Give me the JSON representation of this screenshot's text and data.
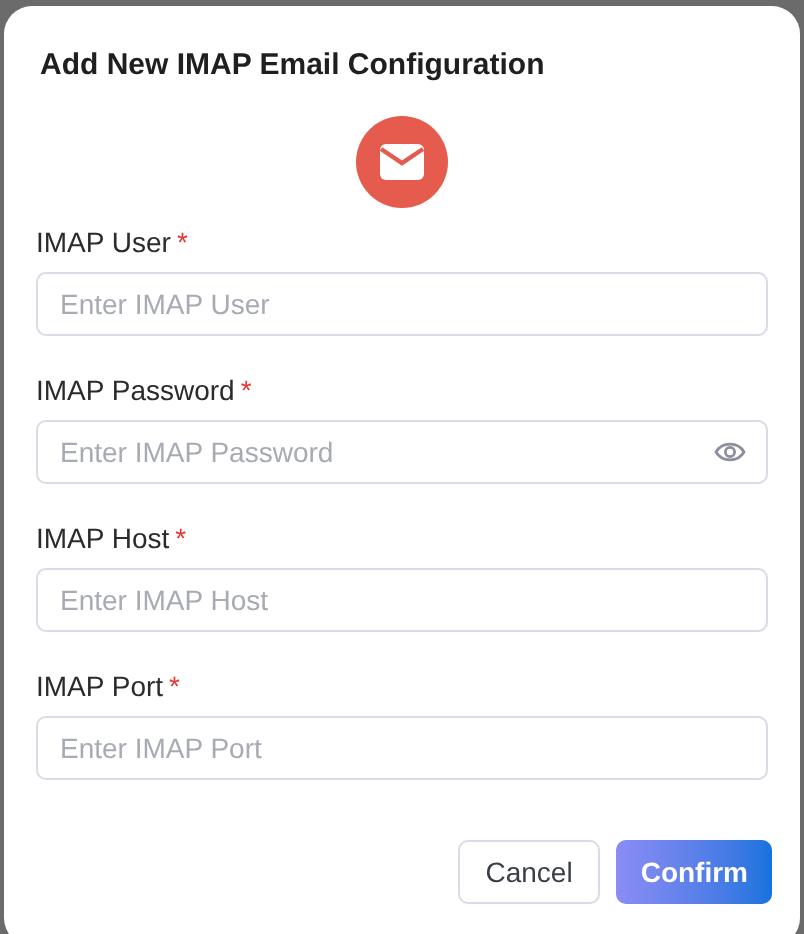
{
  "dialog": {
    "title": "Add New IMAP Email Configuration"
  },
  "fields": [
    {
      "label": "IMAP User",
      "required_mark": "*",
      "kind": "text",
      "placeholder": "Enter IMAP User"
    },
    {
      "label": "IMAP Password",
      "required_mark": "*",
      "kind": "password",
      "placeholder": "Enter IMAP Password"
    },
    {
      "label": "IMAP Host",
      "required_mark": "*",
      "kind": "text",
      "placeholder": "Enter IMAP Host"
    },
    {
      "label": "IMAP Port",
      "required_mark": "*",
      "kind": "text",
      "placeholder": "Enter IMAP Port"
    }
  ],
  "buttons": [
    {
      "label": "Cancel",
      "kind": "secondary"
    },
    {
      "label": "Confirm",
      "kind": "primary"
    }
  ]
}
